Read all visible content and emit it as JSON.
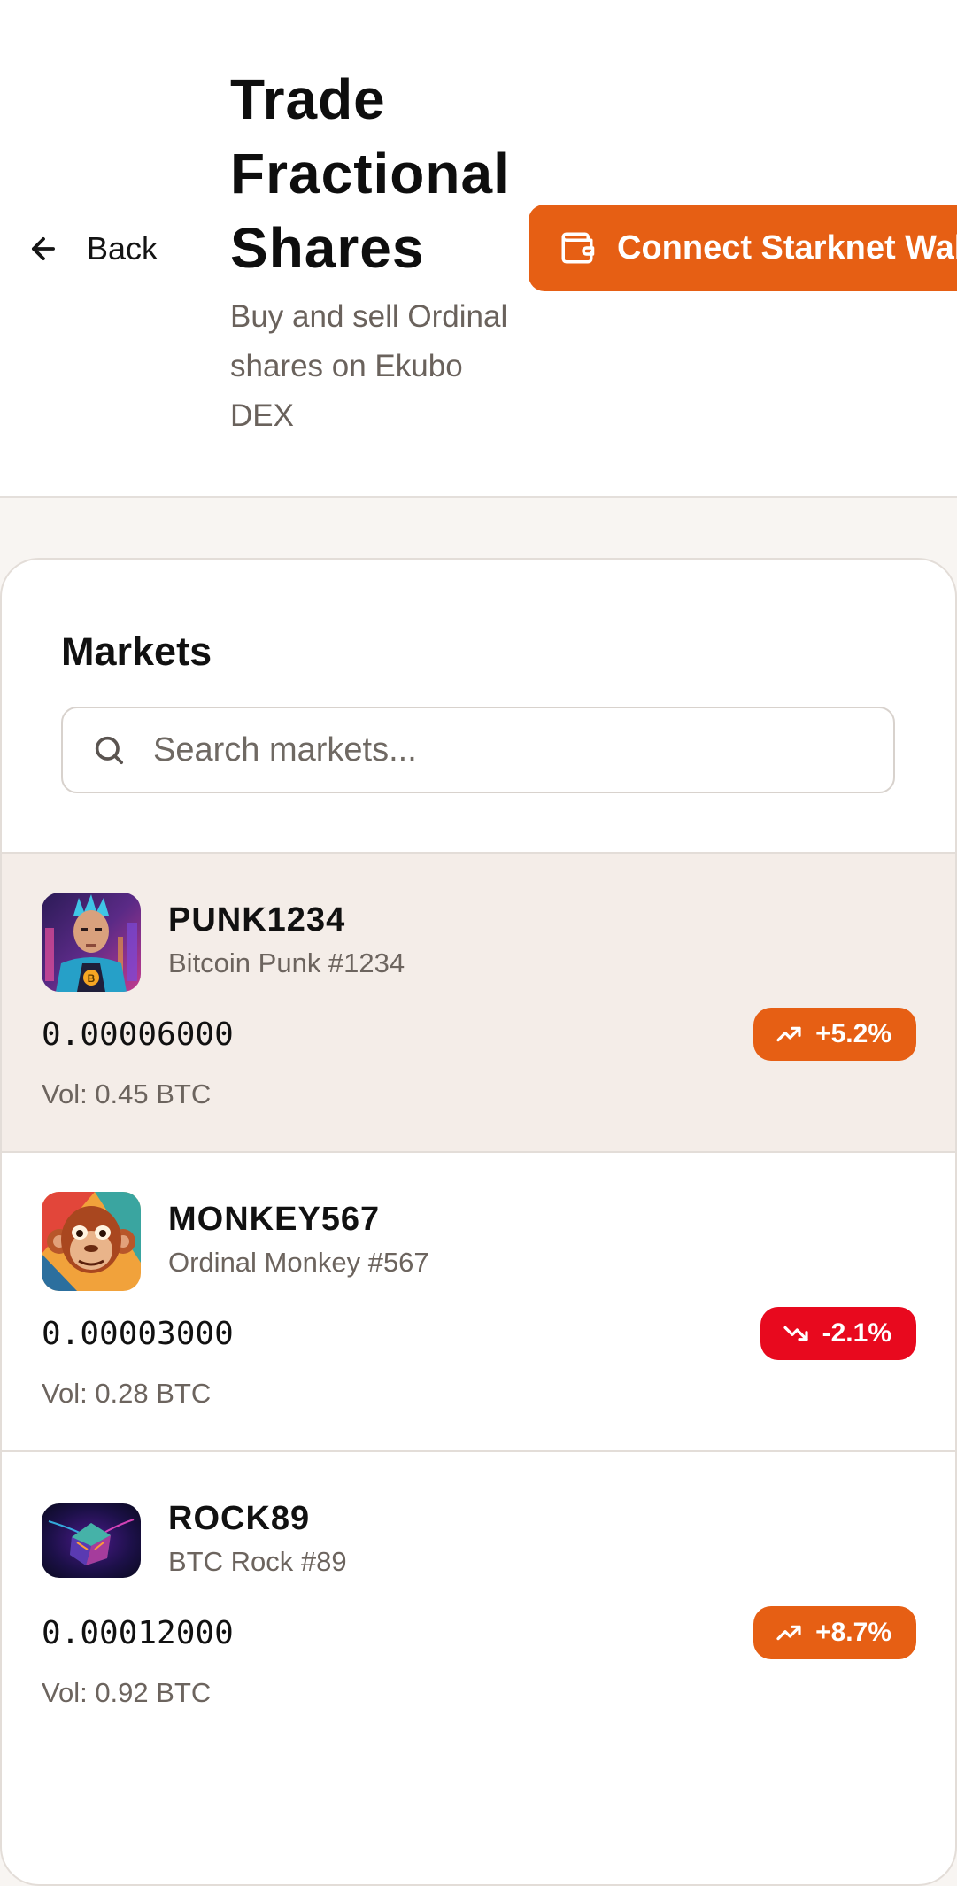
{
  "header": {
    "back_label": "Back",
    "title": "Trade Fractional Shares",
    "subtitle": "Buy and sell Ordinal shares on Ekubo DEX",
    "connect_label": "Connect Starknet Wallet"
  },
  "markets": {
    "title": "Markets",
    "search_placeholder": "Search markets..."
  },
  "rows": [
    {
      "symbol": "PUNK1234",
      "name": "Bitcoin Punk #1234",
      "price": "0.00006000",
      "volume": "Vol: 0.45 BTC",
      "change": "+5.2%",
      "direction": "up",
      "selected": true
    },
    {
      "symbol": "MONKEY567",
      "name": "Ordinal Monkey #567",
      "price": "0.00003000",
      "volume": "Vol: 0.28 BTC",
      "change": "-2.1%",
      "direction": "down",
      "selected": false
    },
    {
      "symbol": "ROCK89",
      "name": "BTC Rock #89",
      "price": "0.00012000",
      "volume": "Vol: 0.92 BTC",
      "change": "+8.7%",
      "direction": "up",
      "selected": false
    }
  ],
  "colors": {
    "accent": "#e65f14",
    "negative": "#e8091e",
    "selected_row": "#f4ede8",
    "page_bg": "#f8f5f2"
  },
  "icons": {
    "back": "arrow-left-icon",
    "wallet": "wallet-icon",
    "search": "search-icon",
    "trend_up": "trending-up-icon",
    "trend_down": "trending-down-icon"
  }
}
